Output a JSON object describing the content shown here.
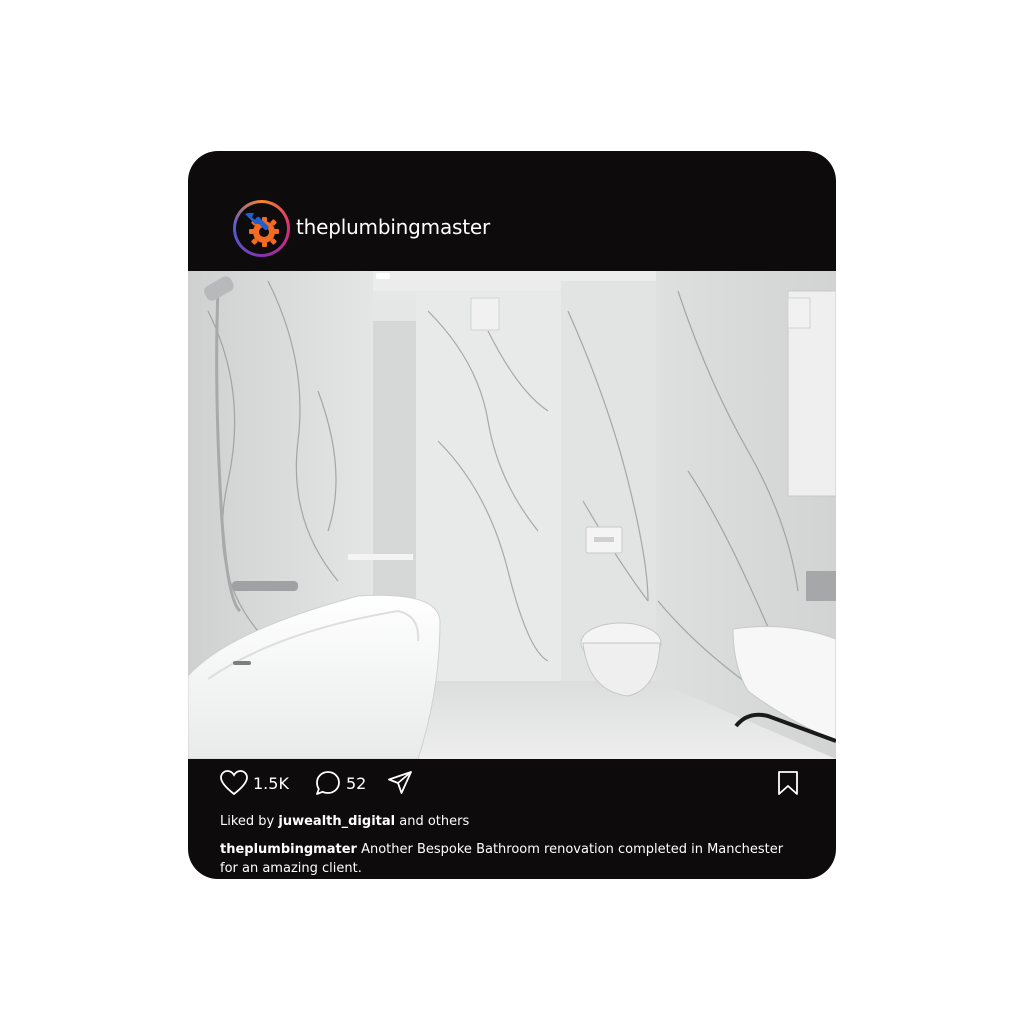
{
  "post": {
    "username": "theplumbingmaster",
    "likes_count": "1.5K",
    "comments_count": "52",
    "liked_by_prefix": "Liked by",
    "liked_by_user": "juwealth_digital",
    "liked_by_suffix": "and others",
    "caption_user": "theplumbingmater",
    "caption_text": "Another Bespoke Bathroom renovation completed in Manchester for an amazing client."
  },
  "icons": {
    "avatar": "gear-wrench-logo-icon",
    "like": "heart-icon",
    "comment": "comment-bubble-icon",
    "share": "paper-plane-icon",
    "save": "bookmark-icon"
  },
  "colors": {
    "card_background": "#0d0b0c",
    "page_background": "#ffffff",
    "text": "#ffffff",
    "logo_orange": "#f26b21",
    "logo_blue": "#1f5fd1"
  }
}
